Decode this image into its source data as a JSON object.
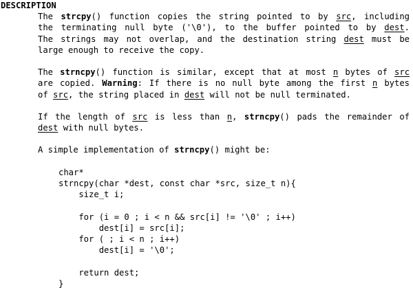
{
  "section": {
    "heading": "DESCRIPTION"
  },
  "p1": {
    "l1a": "The",
    "l1fn": "strcpy",
    "l1b": "()  function  copies the string pointed to by",
    "l1src": "src",
    "l1c": ", including",
    "l2a": "the terminating null byte ('\\0'), to the buffer  pointed  to  by",
    "l2dest": "dest",
    "l2b": ".",
    "l3a": "The  strings  may  not overlap, and the destination string",
    "l3dest": "dest",
    "l3b": "must be",
    "l4": "large enough to receive the copy."
  },
  "p2": {
    "l1a": "The",
    "l1fn": "strncpy",
    "l1b": "() function is similar, except that at most",
    "l1n": "n",
    "l1c": "bytes  of",
    "l1src": "src",
    "l2a": "are  copied.",
    "l2warn": "Warning",
    "l2b": ": If there is no null byte among the first",
    "l2n": "n",
    "l2c": "bytes",
    "l3a": "of",
    "l3src": "src",
    "l3b": ", the string placed in",
    "l3dest": "dest",
    "l3c": "will not be null terminated."
  },
  "p3": {
    "l1a": "If the length of",
    "l1src": "src",
    "l1b": "is less than",
    "l1n": "n",
    "l1c": ",",
    "l1fn": "strncpy",
    "l1d": "() pads  the  remainder  of",
    "l2dest": "dest",
    "l2a": "with null bytes."
  },
  "p4": {
    "a": "A simple implementation of",
    "fn": "strncpy",
    "b": "() might be:"
  },
  "code": {
    "lines": [
      "char*",
      "strncpy(char *dest, const char *src, size_t n){",
      "    size_t i;",
      "",
      "    for (i = 0 ; i < n && src[i] != '\\0' ; i++)",
      "        dest[i] = src[i];",
      "    for ( ; i < n ; i++)",
      "        dest[i] = '\\0';",
      "",
      "    return dest;",
      "}"
    ]
  }
}
